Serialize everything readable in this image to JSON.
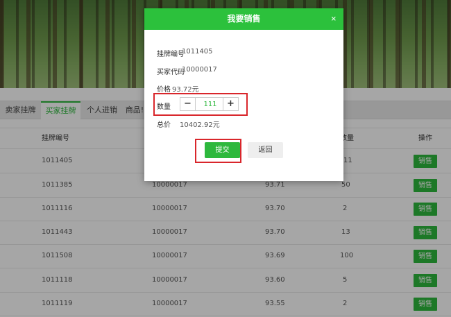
{
  "tabs": [
    "卖家挂牌",
    "买家挂牌",
    "个人进销",
    "商品!"
  ],
  "active_tab": 1,
  "table": {
    "headers": [
      "挂牌编号",
      "数量",
      "操作"
    ],
    "rows": [
      {
        "id": "1011405",
        "code": "",
        "price": "",
        "qty": "11",
        "action": "销售"
      },
      {
        "id": "1011385",
        "code": "10000017",
        "price": "93.71",
        "qty": "50",
        "action": "销售"
      },
      {
        "id": "1011116",
        "code": "10000017",
        "price": "93.70",
        "qty": "2",
        "action": "销售"
      },
      {
        "id": "1011443",
        "code": "10000017",
        "price": "93.70",
        "qty": "13",
        "action": "销售"
      },
      {
        "id": "1011508",
        "code": "10000017",
        "price": "93.69",
        "qty": "100",
        "action": "销售"
      },
      {
        "id": "1011118",
        "code": "10000017",
        "price": "93.60",
        "qty": "5",
        "action": "销售"
      },
      {
        "id": "1011119",
        "code": "10000017",
        "price": "93.55",
        "qty": "2",
        "action": "销售"
      }
    ]
  },
  "modal": {
    "title": "我要销售",
    "close": "×",
    "listing_label": "挂牌编号",
    "listing_value": "1011405",
    "buyer_label": "买家代码",
    "buyer_value": "10000017",
    "price_label": "价格",
    "price_value": "93.72元",
    "qty_label": "数量",
    "qty_value": "111",
    "minus": "−",
    "plus": "+",
    "total_label": "总价",
    "total_value": "10402.92元",
    "submit": "提交",
    "back": "返回"
  },
  "colors": {
    "accent": "#2db83d",
    "header_green": "#2cc13c",
    "highlight_red": "#d9262b"
  }
}
